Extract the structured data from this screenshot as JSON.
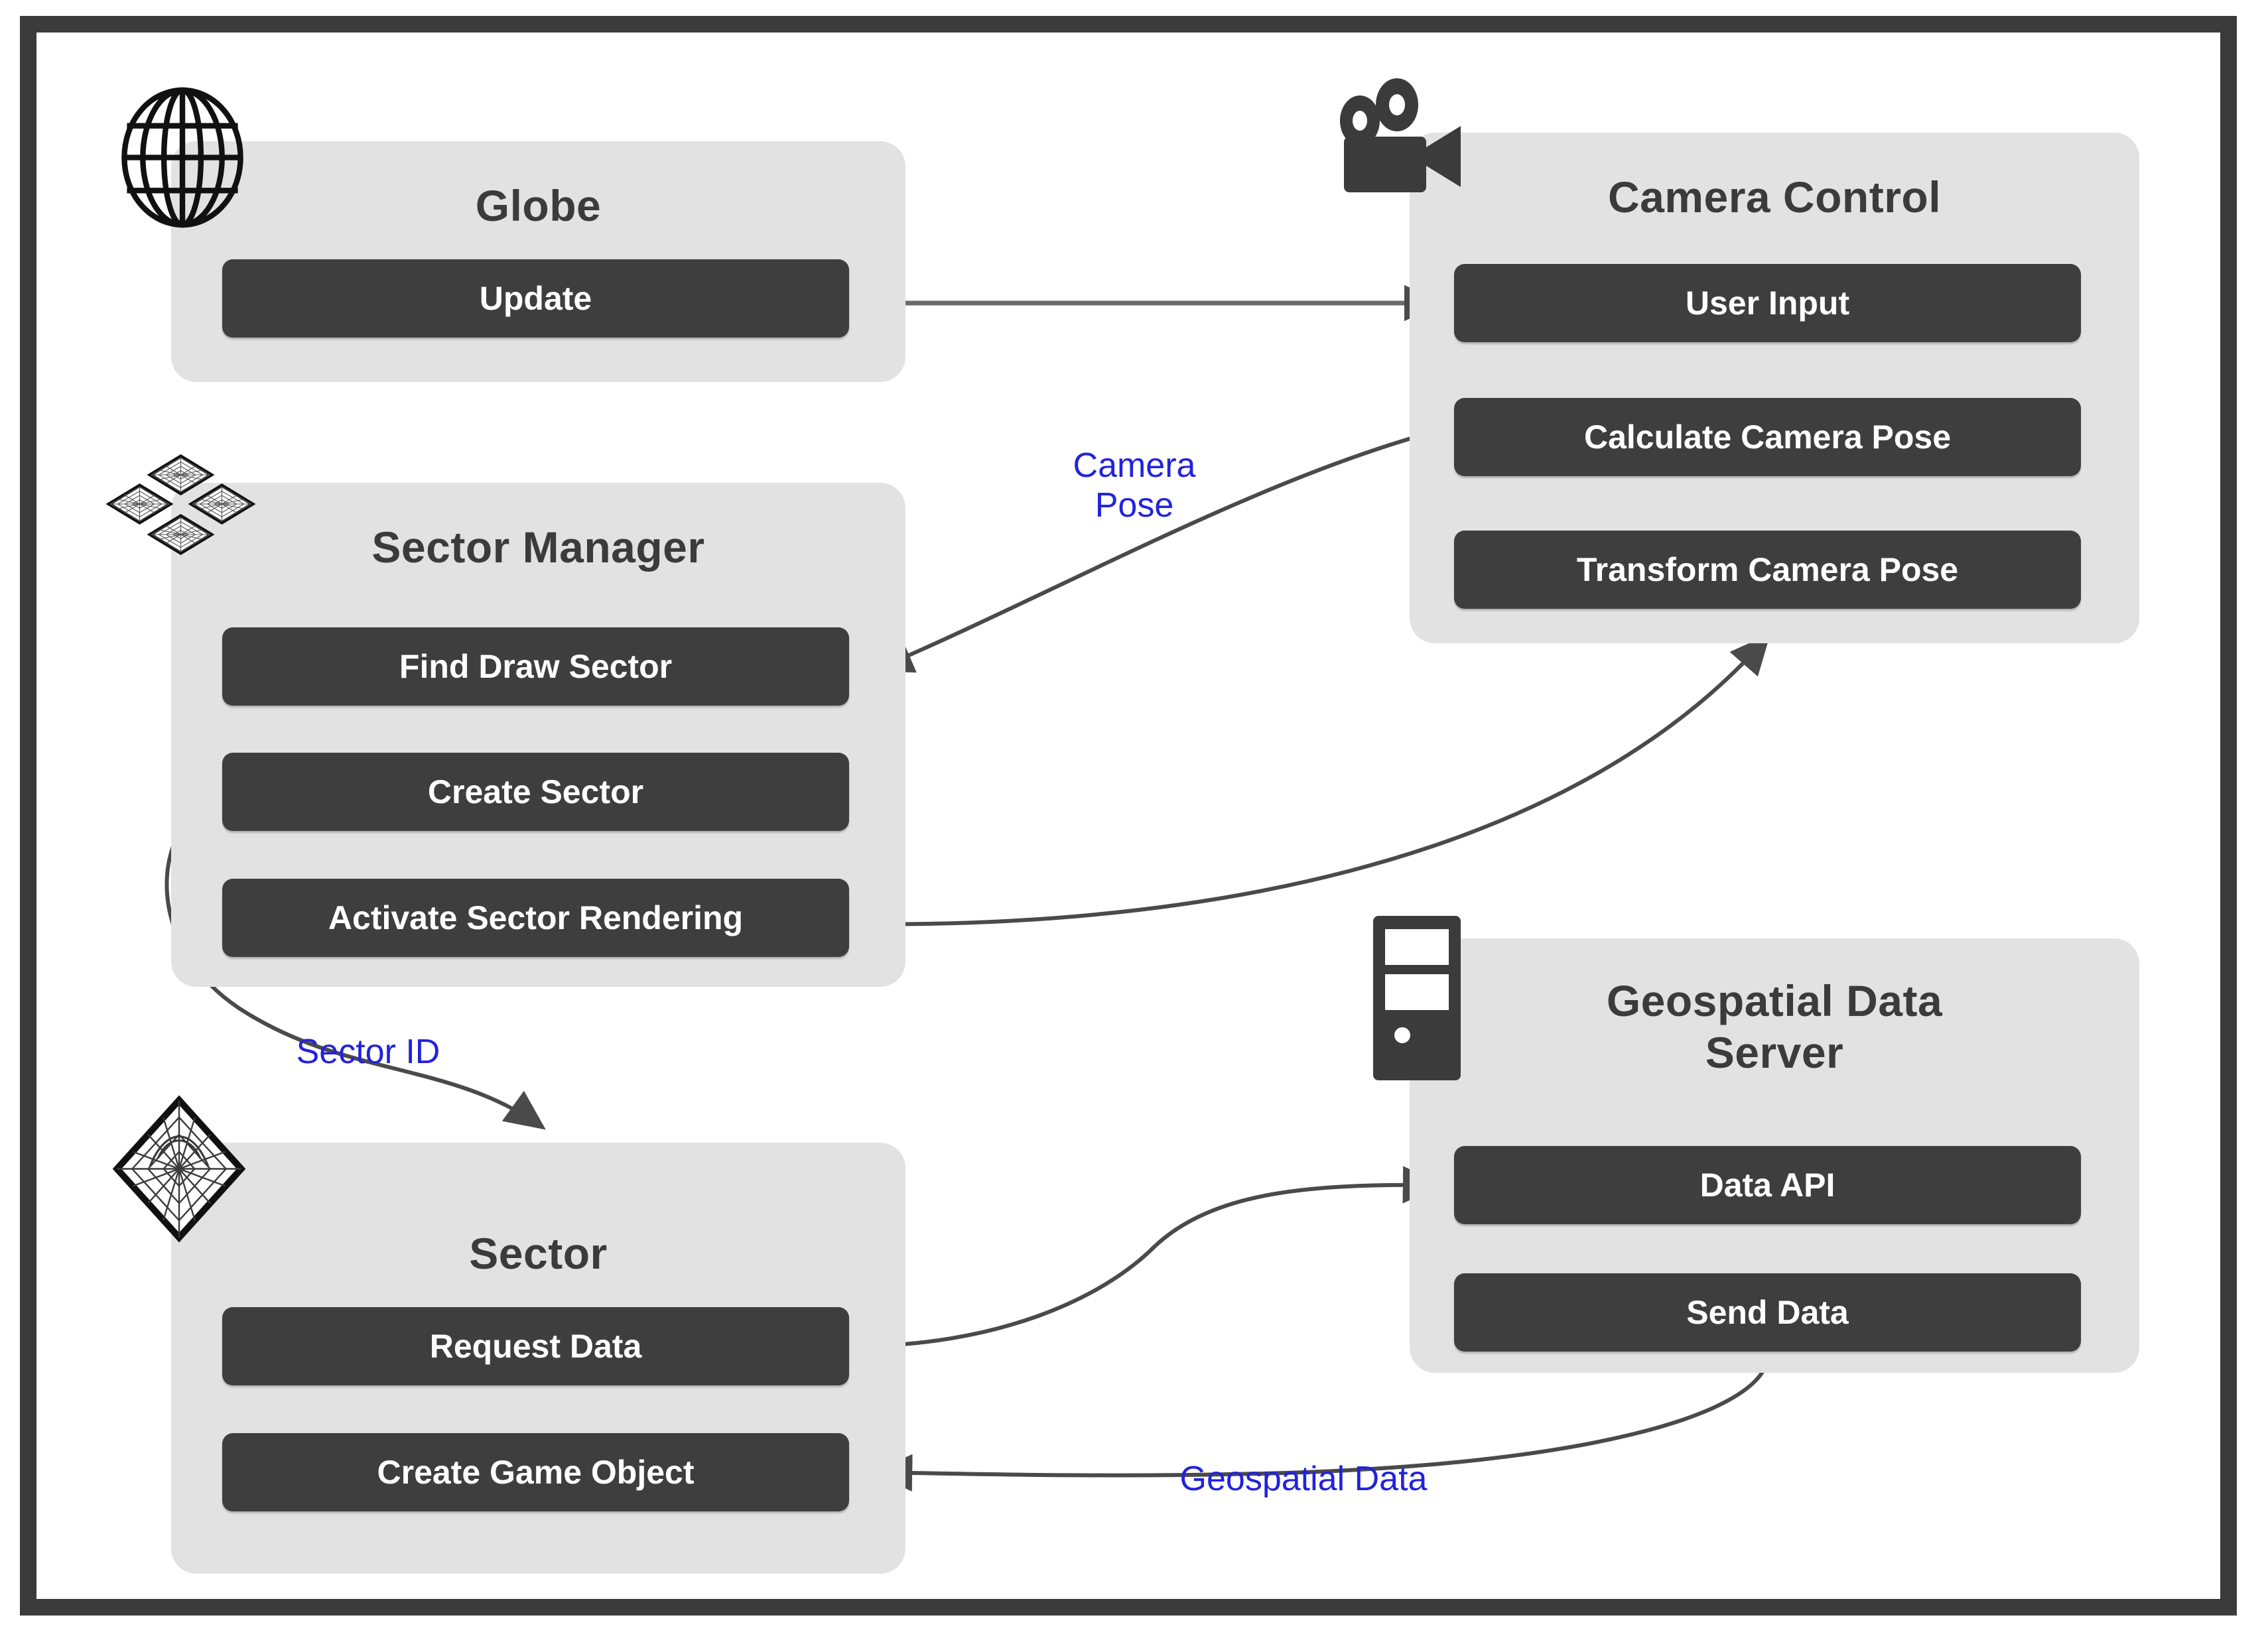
{
  "diagram": {
    "title": "Globe rendering system architecture",
    "colors": {
      "frame": "#3b3b3b",
      "panel": "#e2e2e2",
      "process_box": "#3e3e3e",
      "process_text": "#ffffff",
      "panel_title": "#3b3b3b",
      "flow_label": "#2222dd",
      "connector": "#555555",
      "background": "#ffffff"
    },
    "modules": [
      {
        "id": "globe",
        "title": "Globe",
        "icon": "globe-wireframe-icon",
        "steps": [
          {
            "id": "update",
            "label": "Update"
          }
        ]
      },
      {
        "id": "camera-control",
        "title": "Camera Control",
        "icon": "movie-camera-icon",
        "steps": [
          {
            "id": "user-input",
            "label": "User Input"
          },
          {
            "id": "calculate-camera-pose",
            "label": "Calculate Camera Pose"
          },
          {
            "id": "transform-camera-pose",
            "label": "Transform Camera Pose"
          }
        ]
      },
      {
        "id": "sector-manager",
        "title": "Sector Manager",
        "icon": "sector-grid-icon",
        "steps": [
          {
            "id": "find-draw-sector",
            "label": "Find Draw Sector"
          },
          {
            "id": "create-sector",
            "label": "Create Sector"
          },
          {
            "id": "activate-sector-rendering",
            "label": "Activate Sector Rendering"
          }
        ]
      },
      {
        "id": "sector",
        "title": "Sector",
        "icon": "sector-tile-icon",
        "steps": [
          {
            "id": "request-data",
            "label": "Request Data"
          },
          {
            "id": "create-game-object",
            "label": "Create Game Object"
          }
        ]
      },
      {
        "id": "geospatial-data-server",
        "title": "Geospatial Data\nServer",
        "icon": "server-tower-icon",
        "steps": [
          {
            "id": "data-api",
            "label": "Data API"
          },
          {
            "id": "send-data",
            "label": "Send Data"
          }
        ]
      }
    ],
    "flow_labels": [
      {
        "id": "camera-pose",
        "text": "Camera\nPose"
      },
      {
        "id": "sector-id",
        "text": "Sector ID"
      },
      {
        "id": "geospatial-data",
        "text": "Geospatial Data"
      }
    ],
    "connections": [
      {
        "from": "update",
        "to": "user-input",
        "label": ""
      },
      {
        "from": "user-input",
        "to": "calculate-camera-pose",
        "label": ""
      },
      {
        "from": "calculate-camera-pose",
        "to": "find-draw-sector",
        "label": "Camera Pose"
      },
      {
        "from": "find-draw-sector",
        "to": "create-sector",
        "label": ""
      },
      {
        "from": "create-sector",
        "to": "activate-sector-rendering",
        "label": ""
      },
      {
        "from": "activate-sector-rendering",
        "to": "transform-camera-pose",
        "label": ""
      },
      {
        "from": "create-sector",
        "to": "sector",
        "label": "Sector ID"
      },
      {
        "from": "request-data",
        "to": "data-api",
        "label": ""
      },
      {
        "from": "data-api",
        "to": "send-data",
        "label": ""
      },
      {
        "from": "send-data",
        "to": "create-game-object",
        "label": "Geospatial Data"
      }
    ]
  }
}
